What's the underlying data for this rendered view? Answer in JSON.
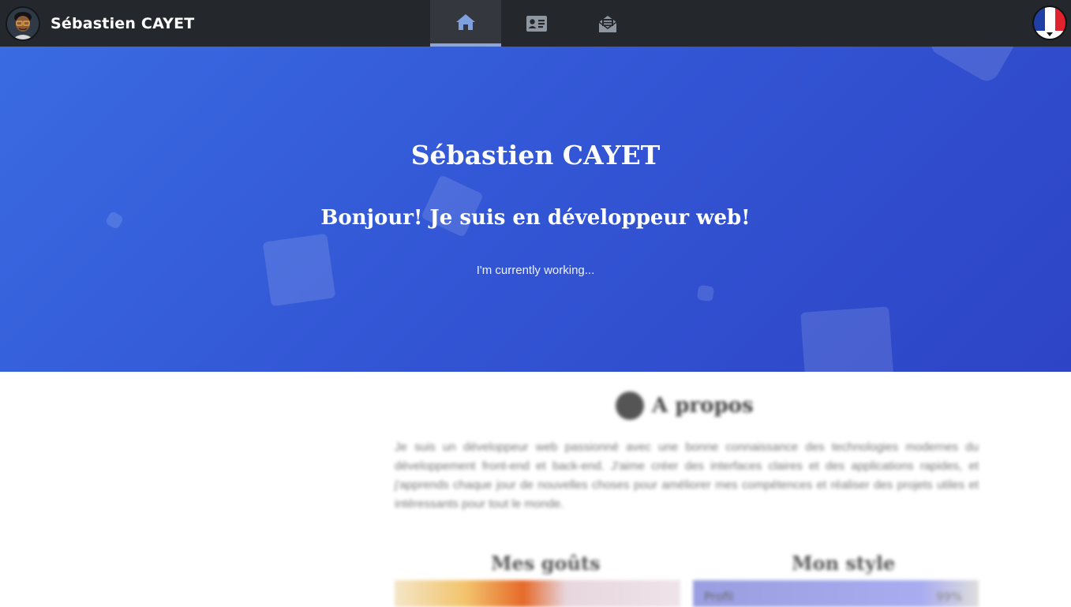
{
  "navbar": {
    "brand_name": "Sébastien CAYET",
    "avatar_icon": "avatar-icon",
    "tabs": [
      {
        "icon": "home-icon",
        "active": true
      },
      {
        "icon": "id-card-icon",
        "active": false
      },
      {
        "icon": "envelope-open-icon",
        "active": false
      }
    ],
    "language_icon": "france-flag-icon",
    "colors": {
      "background": "#24272b",
      "active_tab": "#34383e",
      "active_underline": "#8aa6dc",
      "icon": "#8e96a0",
      "active_icon": "#7fa0de"
    }
  },
  "hero": {
    "title": "Sébastien CAYET",
    "subtitle": "Bonjour! Je suis en développeur web!",
    "status": "I'm currently working...",
    "colors": {
      "gradient_start": "#3a6be2",
      "gradient_end": "#2d44c6"
    }
  },
  "content": {
    "about_title": "A propos",
    "about_text": "Je suis un développeur web passionné avec une bonne connaissance des technologies modernes du développement front-end et back-end. J'aime créer des interfaces claires et des applications rapides, et j'apprends chaque jour de nouvelles choses pour améliorer mes compétences et réaliser des projets utiles et intéressants pour tout le monde.",
    "left_column_title": "Mes goûts",
    "right_column_title": "Mon style",
    "right_bar_label": "Profil",
    "right_bar_value": "99%"
  }
}
